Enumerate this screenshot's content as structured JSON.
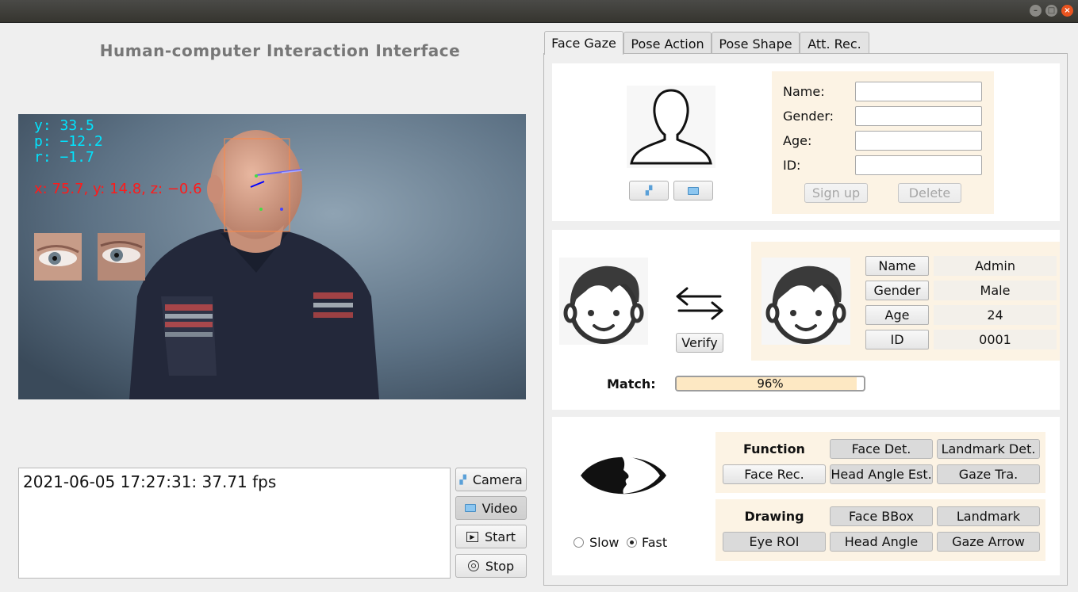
{
  "app": {
    "title": "Human-computer Interaction Interface"
  },
  "window_controls": {
    "minimize": "–",
    "maximize": "□",
    "close": "×"
  },
  "video_overlay": {
    "yaw": "y:   33.5",
    "pitch": "p:  −12.2",
    "roll": "r:   −1.7",
    "position": "x: 75.7,   y: 14.8,   z: −0.6"
  },
  "log": {
    "text": "2021-06-05 17:27:31:  37.71 fps"
  },
  "controls": {
    "camera": "Camera",
    "video": "Video",
    "start": "Start",
    "stop": "Stop"
  },
  "tabs": [
    "Face Gaze",
    "Pose Action",
    "Pose Shape",
    "Att. Rec."
  ],
  "register": {
    "name_label": "Name:",
    "gender_label": "Gender:",
    "age_label": "Age:",
    "id_label": "ID:",
    "name_value": "",
    "gender_value": "",
    "age_value": "",
    "id_value": "",
    "signup": "Sign up",
    "delete": "Delete"
  },
  "verify": {
    "button": "Verify",
    "fields": [
      {
        "label": "Name",
        "value": "Admin"
      },
      {
        "label": "Gender",
        "value": "Male"
      },
      {
        "label": "Age",
        "value": "24"
      },
      {
        "label": "ID",
        "value": "0001"
      }
    ],
    "match_label": "Match:",
    "match_text": "96%",
    "match_value": 0.96
  },
  "functions": {
    "function_title": "Function",
    "drawing_title": "Drawing",
    "face_det": "Face Det.",
    "landmark_det": "Landmark Det.",
    "face_rec": "Face Rec.",
    "head_angle_est": "Head Angle Est.",
    "gaze_tra": "Gaze Tra.",
    "face_bbox": "Face BBox",
    "landmark": "Landmark",
    "eye_roi": "Eye ROI",
    "head_angle": "Head Angle",
    "gaze_arrow": "Gaze Arrow"
  },
  "speed": {
    "slow": "Slow",
    "fast": "Fast",
    "selected": "fast"
  },
  "colors": {
    "cream": "#fcf3e4",
    "progress_fill": "#fde8c3",
    "overlay_cyan": "#00e5ff",
    "overlay_red": "#ff1a1a",
    "close": "#e95420"
  }
}
